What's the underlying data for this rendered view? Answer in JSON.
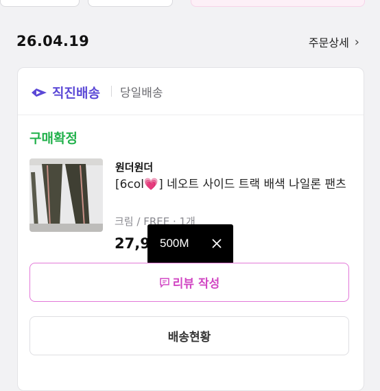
{
  "order": {
    "date": "26.04.19",
    "detail_label": "주문상세"
  },
  "shipping": {
    "brand_label": "직진배송",
    "type_label": "당일배송",
    "brand_color": "#5b48d6"
  },
  "status": {
    "label": "구매확정",
    "color": "#22b14c"
  },
  "product": {
    "brand": "원더원더",
    "title_prefix": "[6col",
    "title_suffix": "] 네오트 사이드 트랙 배색 나일론 팬츠",
    "option": "크림 / FREE · 1개",
    "price": "27,900원",
    "thumbnail_icon": "product-photo"
  },
  "tooltip": {
    "label": "500M"
  },
  "buttons": {
    "review": "리뷰 작성",
    "shipping_status": "배송현황"
  },
  "colors": {
    "accent_pink": "#d146c3",
    "heart": "#ff4fa3"
  }
}
